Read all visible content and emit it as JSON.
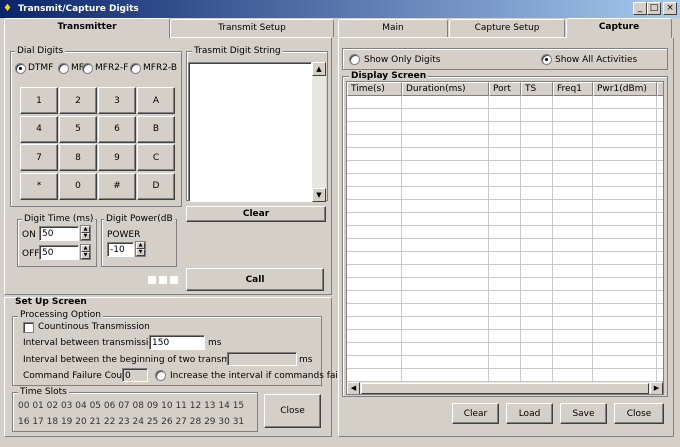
{
  "window": {
    "title": "Transmit/Capture Digits",
    "min": "_",
    "max": "□",
    "close": "×"
  },
  "left_tabs": [
    "Transmitter",
    "Transmit Setup"
  ],
  "right_tabs": [
    "Main",
    "Capture Setup",
    "Capture"
  ],
  "dial_digits": {
    "label": "Dial Digits",
    "options": [
      "DTMF",
      "MF",
      "MFR2-F",
      "MFR2-B"
    ],
    "selected": "DTMF",
    "keys": [
      "1",
      "2",
      "3",
      "A",
      "4",
      "5",
      "6",
      "B",
      "7",
      "8",
      "9",
      "C",
      "*",
      "0",
      "#",
      "D"
    ]
  },
  "transmit_string": {
    "label": "Trasmit Digit String",
    "clear": "Clear",
    "call": "Call"
  },
  "digit_time": {
    "label": "Digit Time (ms)",
    "on_label": "ON",
    "on_value": "50",
    "off_label": "OFF",
    "off_value": "50"
  },
  "digit_power": {
    "label": "Digit Power(dB",
    "power_label": "POWER",
    "power_value": "-10"
  },
  "setup": {
    "title": "Set Up Screen",
    "processing_label": "Processing Option",
    "continuous": "Countinous Transmission",
    "interval_label": "Interval between transmissions:",
    "interval_value": "150",
    "interval_unit": "ms",
    "begin_label": "Interval between the beginning of two transmissions:",
    "begin_value": "",
    "begin_unit": "ms",
    "fail_label": "Command Failure Count:",
    "fail_value": "0",
    "increase_label": "Increase the interval if commands fail."
  },
  "time_slots": {
    "label": "Time Slots",
    "row1": "00 01 02 03 04 05 06 07 08 09 10 11 12 13 14 15",
    "row2": "16 17 18 19 20 21 22 23 24 25 26 27 28 29 30 31"
  },
  "left_close": "Close",
  "capture": {
    "show_digits": "Show Only Digits",
    "show_all": "Show All Activities",
    "selected": "Show All Activities",
    "display_label": "Display Screen",
    "columns": [
      "Time(s)",
      "Duration(ms)",
      "Port",
      "TS",
      "Freq1",
      "Pwr1(dBm)"
    ],
    "buttons": [
      "Clear",
      "Load",
      "Save",
      "Close"
    ]
  }
}
